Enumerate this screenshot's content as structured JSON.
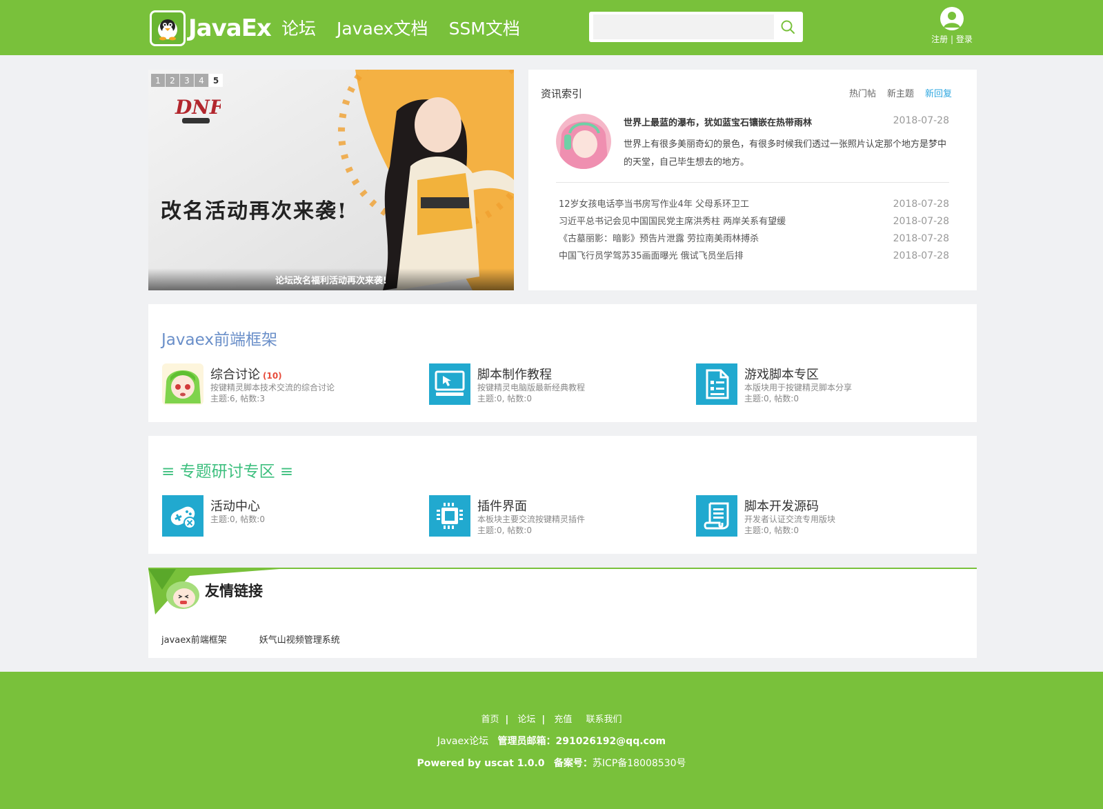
{
  "header": {
    "logo_text": "JavaEx",
    "nav": [
      "论坛",
      "Javaex文档",
      "SSM文档"
    ],
    "search_placeholder": "",
    "register": "注册",
    "separator": "|",
    "login": "登录"
  },
  "banner": {
    "pages": [
      "1",
      "2",
      "3",
      "4",
      "5"
    ],
    "active_page": "5",
    "image_title": "改名活动再次来袭!",
    "caption": "论坛改名福利活动再次来袭!"
  },
  "news": {
    "title": "资讯索引",
    "tabs": [
      "热门帖",
      "新主题",
      "新回复"
    ],
    "active_tab": "新回复",
    "featured": {
      "headline": "世界上最蓝的瀑布，犹如蓝宝石镶嵌在热带雨林",
      "date": "2018-07-28",
      "summary": "世界上有很多美丽奇幻的景色，有很多时候我们透过一张照片认定那个地方是梦中的天堂，自己毕生想去的地方。"
    },
    "items": [
      {
        "text": "12岁女孩电话亭当书房写作业4年 父母系环卫工",
        "date": "2018-07-28"
      },
      {
        "text": "习近平总书记会见中国国民党主席洪秀柱 两岸关系有望缓",
        "date": "2018-07-28"
      },
      {
        "text": "《古墓丽影：暗影》预告片泄露 劳拉南美雨林搏杀",
        "date": "2018-07-28"
      },
      {
        "text": "中国飞行员学驾苏35画面曝光 俄试飞员坐后排",
        "date": "2018-07-28"
      }
    ]
  },
  "section1": {
    "title": "Javaex前端框架",
    "boards": [
      {
        "name": "综合讨论",
        "badge": "(10)",
        "desc": "按键精灵脚本技术交流的综合讨论",
        "stats": "主题:6, 帖数:3",
        "icon": "anime-girl-icon"
      },
      {
        "name": "脚本制作教程",
        "badge": "",
        "desc": "按键精灵电脑版最新经典教程",
        "stats": "主题:0, 帖数:0",
        "icon": "computer-icon"
      },
      {
        "name": "游戏脚本专区",
        "badge": "",
        "desc": "本版块用于按键精灵脚本分享",
        "stats": "主题:0, 帖数:0",
        "icon": "document-icon"
      }
    ]
  },
  "section2": {
    "title": "≡ 专题研讨专区 ≡",
    "boards": [
      {
        "name": "活动中心",
        "desc": "",
        "stats": "主题:0, 帖数:0",
        "icon": "gamepad-icon"
      },
      {
        "name": "插件界面",
        "desc": "本板块主要交流按键精灵插件",
        "stats": "主题:0, 帖数:0",
        "icon": "chip-icon"
      },
      {
        "name": "脚本开发源码",
        "desc": "开发者认证交流专用版块",
        "stats": "主题:0, 帖数:0",
        "icon": "scroll-icon"
      }
    ]
  },
  "friend_links": {
    "title": "友情链接",
    "links": [
      "javaex前端框架",
      "妖气山视频管理系统"
    ]
  },
  "footer": {
    "nav": [
      "首页",
      "论坛",
      "充值",
      "联系我们"
    ],
    "nav_sep": "|",
    "site": "Javaex论坛",
    "email_label": "管理员邮箱：",
    "email": "291026192@qq.com",
    "powered": "Powered by uscat 1.0.0",
    "icp_label": "备案号：",
    "icp": "苏ICP备18008530号"
  },
  "colors": {
    "brand_green": "#79c13b",
    "board_icon_blue": "#21a9cf",
    "section1_title": "#6a8fc9",
    "section2_title": "#3dbf7e",
    "active_tab": "#2ea7e0"
  }
}
